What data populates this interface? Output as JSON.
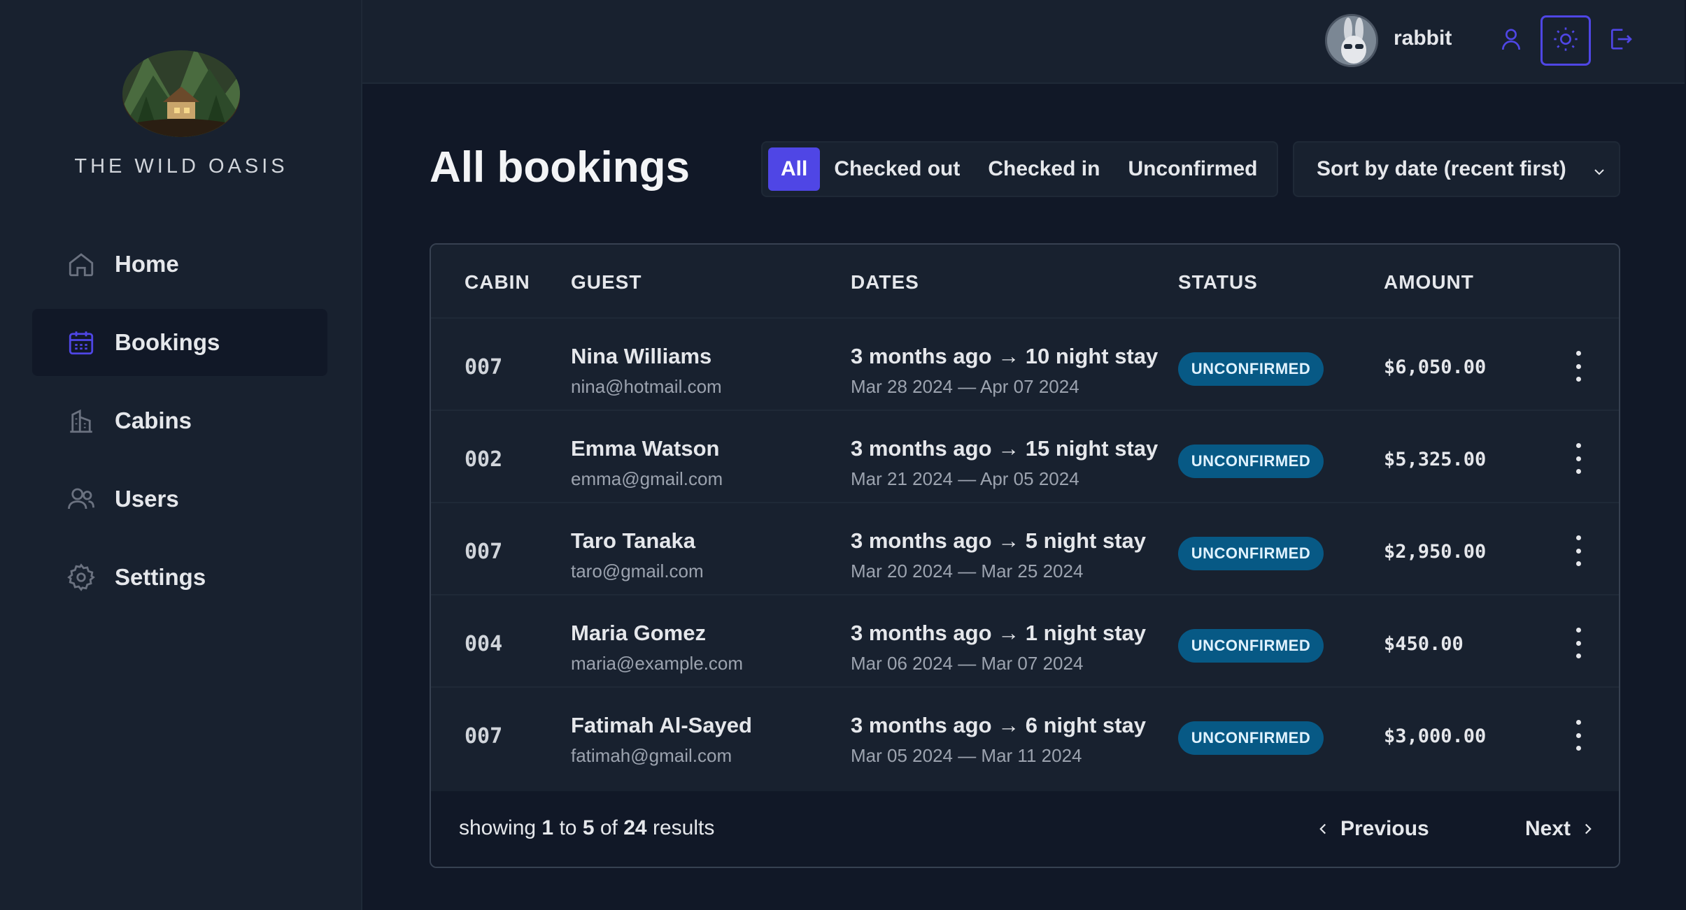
{
  "brand": {
    "name": "THE WILD OASIS"
  },
  "sidebar": {
    "items": [
      {
        "label": "Home",
        "icon": "home-icon",
        "active": false
      },
      {
        "label": "Bookings",
        "icon": "calendar-icon",
        "active": true
      },
      {
        "label": "Cabins",
        "icon": "building-icon",
        "active": false
      },
      {
        "label": "Users",
        "icon": "users-icon",
        "active": false
      },
      {
        "label": "Settings",
        "icon": "gear-icon",
        "active": false
      }
    ]
  },
  "header": {
    "username": "rabbit"
  },
  "page": {
    "title": "All bookings"
  },
  "filters": {
    "options": [
      "All",
      "Checked out",
      "Checked in",
      "Unconfirmed"
    ],
    "active": "All"
  },
  "sort": {
    "selected": "Sort by date (recent first)"
  },
  "table": {
    "headers": [
      "CABIN",
      "GUEST",
      "DATES",
      "STATUS",
      "AMOUNT"
    ],
    "rows": [
      {
        "cabin": "007",
        "name": "Nina Williams",
        "email": "nina@hotmail.com",
        "when": "3 months ago → 10 night stay",
        "range": "Mar 28 2024 — Apr 07 2024",
        "status": "UNCONFIRMED",
        "amount": "$6,050.00"
      },
      {
        "cabin": "002",
        "name": "Emma Watson",
        "email": "emma@gmail.com",
        "when": "3 months ago → 15 night stay",
        "range": "Mar 21 2024 — Apr 05 2024",
        "status": "UNCONFIRMED",
        "amount": "$5,325.00"
      },
      {
        "cabin": "007",
        "name": "Taro Tanaka",
        "email": "taro@gmail.com",
        "when": "3 months ago → 5 night stay",
        "range": "Mar 20 2024 — Mar 25 2024",
        "status": "UNCONFIRMED",
        "amount": "$2,950.00"
      },
      {
        "cabin": "004",
        "name": "Maria Gomez",
        "email": "maria@example.com",
        "when": "3 months ago → 1 night stay",
        "range": "Mar 06 2024 — Mar 07 2024",
        "status": "UNCONFIRMED",
        "amount": "$450.00"
      },
      {
        "cabin": "007",
        "name": "Fatimah Al-Sayed",
        "email": "fatimah@gmail.com",
        "when": "3 months ago → 6 night stay",
        "range": "Mar 05 2024 — Mar 11 2024",
        "status": "UNCONFIRMED",
        "amount": "$3,000.00"
      }
    ]
  },
  "pagination": {
    "showing_prefix": "showing",
    "from": "1",
    "to_word": "to",
    "to": "5",
    "of_word": "of",
    "total": "24",
    "results_word": "results",
    "prev_label": "Previous",
    "next_label": "Next"
  },
  "colors": {
    "accent": "#4f46e5",
    "badge_bg": "#075985",
    "bg": "#111827",
    "panel": "#18212f"
  }
}
